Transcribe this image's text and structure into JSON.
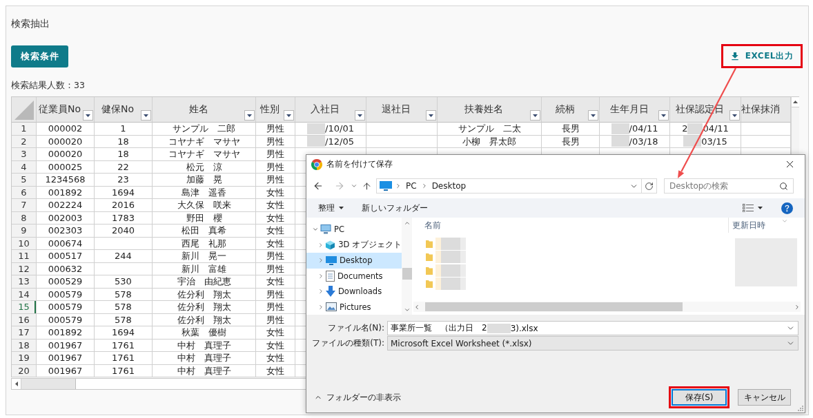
{
  "page": {
    "title": "検索抽出"
  },
  "search_conditions_button": {
    "label": "検索条件"
  },
  "excel_button": {
    "label": "EXCEL出力",
    "highlighted": true
  },
  "result_count": "検索結果人数：33",
  "table": {
    "columns": [
      {
        "label": "従業員No",
        "has_filter": true
      },
      {
        "label": "健保No",
        "has_filter": true
      },
      {
        "label": "姓名",
        "has_filter": true
      },
      {
        "label": "性別",
        "has_filter": true
      },
      {
        "label": "入社日",
        "has_filter": true
      },
      {
        "label": "退社日",
        "has_filter": true
      },
      {
        "label": "扶養姓名",
        "has_filter": true
      },
      {
        "label": "続柄",
        "has_filter": true
      },
      {
        "label": "生年月日",
        "has_filter": true
      },
      {
        "label": "社保認定日",
        "has_filter": true
      },
      {
        "label": "社保抹消",
        "has_filter": false
      }
    ],
    "rows": [
      {
        "number": "1",
        "selected": false,
        "cells": [
          "000002",
          "1",
          "サンプル　二郎",
          "男性",
          {
            "tail": "/10/01"
          },
          null,
          "サンプル　二太",
          "長男",
          {
            "tail": "/04/11"
          },
          {
            "lead": "2",
            "tail": "04/11"
          },
          null
        ]
      },
      {
        "number": "2",
        "selected": false,
        "cells": [
          "000020",
          "18",
          "コヤナギ　マサヤ",
          "男性",
          {
            "tail": "/12/05"
          },
          null,
          "小柳　昇太郎",
          "長男",
          {
            "tail": "/03/18"
          },
          {
            "tail": "03/15"
          },
          null
        ]
      },
      {
        "number": "3",
        "selected": false,
        "cells": [
          "000020",
          "18",
          "コヤナギ　マサヤ",
          "男性"
        ]
      },
      {
        "number": "4",
        "selected": false,
        "cells": [
          "000025",
          "22",
          "松元　涼",
          "男性"
        ]
      },
      {
        "number": "5",
        "selected": false,
        "cells": [
          "1234568",
          "23",
          "加藤　晃",
          "男性"
        ]
      },
      {
        "number": "6",
        "selected": false,
        "cells": [
          "001892",
          "1694",
          "島津　遥香",
          "女性"
        ]
      },
      {
        "number": "7",
        "selected": false,
        "cells": [
          "002224",
          "2016",
          "大久保　咲来",
          "女性"
        ]
      },
      {
        "number": "8",
        "selected": false,
        "cells": [
          "002003",
          "1783",
          "野田　櫻",
          "女性"
        ]
      },
      {
        "number": "9",
        "selected": false,
        "cells": [
          "002303",
          "2040",
          "松田　真希",
          "女性"
        ]
      },
      {
        "number": "10",
        "selected": false,
        "cells": [
          "000674",
          null,
          "西尾　礼那",
          "女性"
        ]
      },
      {
        "number": "11",
        "selected": false,
        "cells": [
          "000517",
          "244",
          "新川　晃一",
          "男性"
        ]
      },
      {
        "number": "12",
        "selected": false,
        "cells": [
          "000632",
          null,
          "新川　富雄",
          "男性"
        ]
      },
      {
        "number": "13",
        "selected": false,
        "cells": [
          "000529",
          "530",
          "宇治　由紀恵",
          "女性"
        ]
      },
      {
        "number": "14",
        "selected": false,
        "cells": [
          "000579",
          "578",
          "佐分利　翔太",
          "男性"
        ]
      },
      {
        "number": "15",
        "selected": true,
        "cells": [
          "000579",
          "578",
          "佐分利　翔太",
          "男性"
        ]
      },
      {
        "number": "16",
        "selected": false,
        "cells": [
          "000579",
          "578",
          "佐分利　翔太",
          "男性"
        ]
      },
      {
        "number": "17",
        "selected": false,
        "cells": [
          "001892",
          "1694",
          "秋葉　優樹",
          "女性"
        ]
      },
      {
        "number": "18",
        "selected": false,
        "cells": [
          "001967",
          "1761",
          "中村　真理子",
          "女性"
        ]
      },
      {
        "number": "19",
        "selected": false,
        "cells": [
          "001967",
          "1761",
          "中村　真理子",
          "女性"
        ]
      },
      {
        "number": "20",
        "selected": false,
        "cells": [
          "001967",
          "1761",
          "中村　真理子",
          "女性"
        ]
      }
    ]
  },
  "save_dialog": {
    "title": "名前を付けて保存",
    "address": [
      "PC",
      "Desktop"
    ],
    "search": {
      "placeholder": "Desktopの検索"
    },
    "toolbar": {
      "organize": "整理",
      "new_folder": "新しいフォルダー"
    },
    "nav_tree": [
      {
        "label": "PC",
        "kind": "pc",
        "expanded": true,
        "selected": false,
        "children": [
          {
            "label": "3D オブジェクト",
            "kind": "objects3d",
            "expanded": false,
            "selected": false
          },
          {
            "label": "Desktop",
            "kind": "desktop",
            "expanded": false,
            "selected": true
          },
          {
            "label": "Documents",
            "kind": "documents",
            "expanded": false,
            "selected": false
          },
          {
            "label": "Downloads",
            "kind": "downloads",
            "expanded": false,
            "selected": false
          },
          {
            "label": "Pictures",
            "kind": "pictures",
            "expanded": false,
            "selected": false
          }
        ]
      }
    ],
    "file_columns": [
      "名前",
      "更新日時"
    ],
    "files": [
      {
        "kind": "folder"
      },
      {
        "kind": "folder"
      },
      {
        "kind": "folder"
      },
      {
        "kind": "folder"
      }
    ],
    "file_name": {
      "label": "ファイル名(N):",
      "value": {
        "lead": "事業所一覧　（出力日　2",
        "tail": "3).xlsx"
      }
    },
    "file_type": {
      "label": "ファイルの種類(T):",
      "value": "Microsoft Excel Worksheet (*.xlsx)"
    },
    "hide_folders": "フォルダーの非表示",
    "buttons": [
      {
        "label": "保存(S)",
        "kind": "primary",
        "highlighted": true
      },
      {
        "label": "キャンセル",
        "kind": "secondary",
        "highlighted": false
      }
    ]
  }
}
